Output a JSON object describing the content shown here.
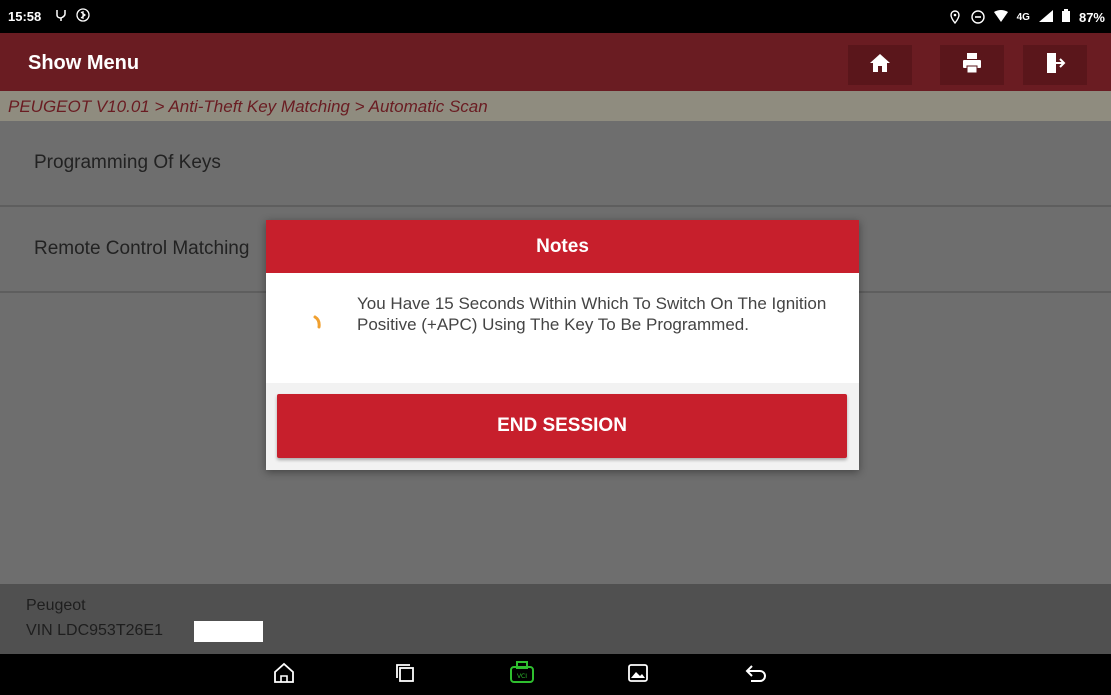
{
  "status_bar": {
    "time": "15:58",
    "network": "4G",
    "battery": "87%",
    "icons": [
      "usb-debug-icon",
      "bluetooth-icon",
      "location-icon",
      "dnd-icon",
      "wifi-icon",
      "signal-icon",
      "battery-icon"
    ]
  },
  "app_bar": {
    "title": "Show Menu",
    "buttons": [
      "home-icon",
      "print-icon",
      "exit-icon"
    ]
  },
  "breadcrumb": "PEUGEOT V10.01 > Anti-Theft Key Matching > Automatic Scan",
  "menu": {
    "items": [
      {
        "label": "Programming Of Keys"
      },
      {
        "label": "Remote Control Matching"
      }
    ]
  },
  "dialog": {
    "title": "Notes",
    "message": "You Have 15 Seconds Within Which To Switch On The Ignition Positive (+APC) Using The Key To Be Programmed.",
    "button": "END SESSION"
  },
  "footer": {
    "make": "Peugeot",
    "vin": "VIN LDC953T26E1"
  },
  "nav_bar": {
    "icons": [
      "home-icon",
      "recents-icon",
      "vci-icon",
      "gallery-icon",
      "back-icon"
    ]
  },
  "colors": {
    "accent": "#c71f2c",
    "appbar": "#6a1c22",
    "vci_green": "#2fbf2f"
  }
}
